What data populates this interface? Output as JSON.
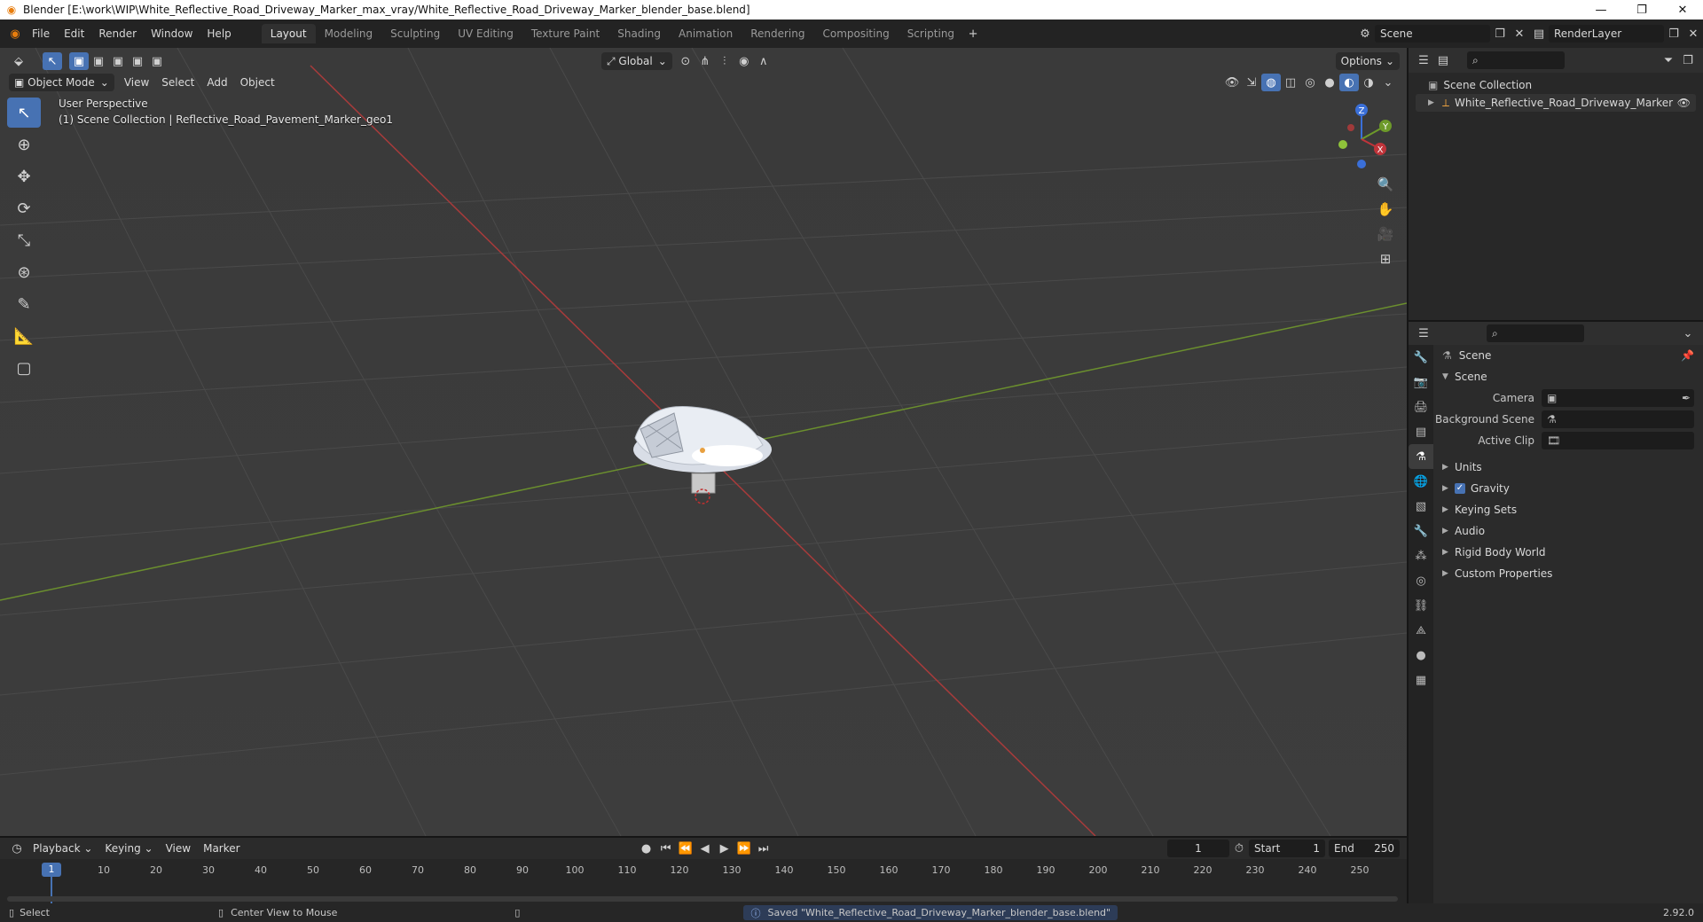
{
  "window": {
    "title": "Blender [E:\\work\\WIP\\White_Reflective_Road_Driveway_Marker_max_vray/White_Reflective_Road_Driveway_Marker_blender_base.blend]",
    "minimize": "—",
    "maximize": "❐",
    "close": "✕"
  },
  "menu": [
    "File",
    "Edit",
    "Render",
    "Window",
    "Help"
  ],
  "workspaces": [
    "Layout",
    "Modeling",
    "Sculpting",
    "UV Editing",
    "Texture Paint",
    "Shading",
    "Animation",
    "Rendering",
    "Compositing",
    "Scripting"
  ],
  "active_workspace": "Layout",
  "scene_field": "Scene",
  "renderlayer_field": "RenderLayer",
  "viewport": {
    "mode": "Object Mode",
    "menus": [
      "View",
      "Select",
      "Add",
      "Object"
    ],
    "orientation": "Global",
    "options": "Options",
    "perspective_label": "User Perspective",
    "collection_label": "(1) Scene Collection | Reflective_Road_Pavement_Marker_geo1",
    "gizmo": {
      "x": "X",
      "y": "Y",
      "z": "Z"
    }
  },
  "outliner": {
    "root": "Scene Collection",
    "items": [
      "White_Reflective_Road_Driveway_Marker"
    ]
  },
  "properties": {
    "header_title": "Scene",
    "section": "Scene",
    "fields": [
      {
        "label": "Camera",
        "value": ""
      },
      {
        "label": "Background Scene",
        "value": ""
      },
      {
        "label": "Active Clip",
        "value": ""
      }
    ],
    "panels": [
      "Units",
      "Gravity",
      "Keying Sets",
      "Audio",
      "Rigid Body World",
      "Custom Properties"
    ],
    "gravity_checked": true
  },
  "timeline": {
    "menus": [
      "Playback",
      "Keying",
      "View",
      "Marker"
    ],
    "current_frame": "1",
    "start_label": "Start",
    "start": "1",
    "end_label": "End",
    "end": "250",
    "ticks": [
      "10",
      "20",
      "30",
      "40",
      "50",
      "60",
      "70",
      "80",
      "90",
      "100",
      "110",
      "120",
      "130",
      "140",
      "150",
      "160",
      "170",
      "180",
      "190",
      "200",
      "210",
      "220",
      "230",
      "240",
      "250"
    ],
    "current_tick": "1"
  },
  "status": {
    "select": "Select",
    "center_view": "Center View to Mouse",
    "message": "Saved \"White_Reflective_Road_Driveway_Marker_blender_base.blend\"",
    "version": "2.92.0"
  }
}
